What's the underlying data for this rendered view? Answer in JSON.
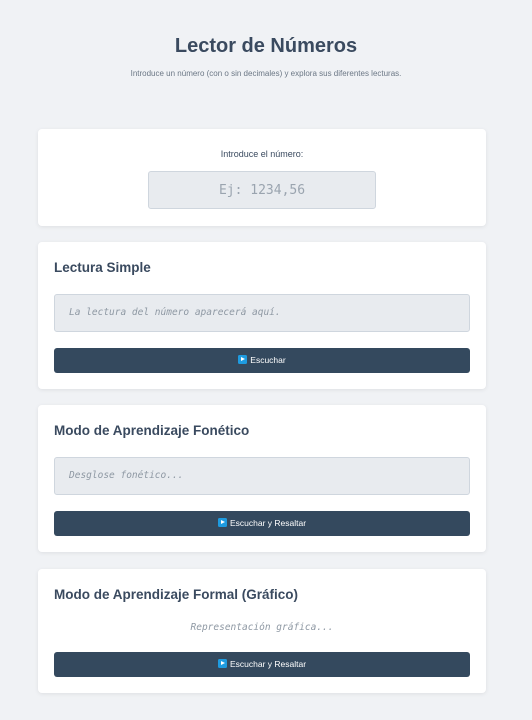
{
  "header": {
    "title": "Lector de Números",
    "subtitle": "Introduce un número (con o sin decimales) y explora sus diferentes lecturas."
  },
  "number_input": {
    "label": "Introduce el número:",
    "placeholder": "Ej: 1234,56",
    "value": ""
  },
  "simple_reading": {
    "title": "Lectura Simple",
    "output_placeholder": "La lectura del número aparecerá aquí.",
    "button_icon": "play-icon",
    "button_label": "Escuchar"
  },
  "phonetic_mode": {
    "title": "Modo de Aprendizaje Fonético",
    "output_placeholder": "Desglose fonético...",
    "button_icon": "play-icon",
    "button_label": "Escuchar y Resaltar"
  },
  "formal_mode": {
    "title": "Modo de Aprendizaje Formal (Gráfico)",
    "graphic_placeholder": "Representación gráfica...",
    "button_icon": "play-icon",
    "button_label": "Escuchar y Resaltar"
  },
  "colors": {
    "background": "#f0f2f5",
    "card": "#ffffff",
    "button": "#34495e",
    "icon_accent": "#1e9be0",
    "field": "#e8ebef"
  }
}
